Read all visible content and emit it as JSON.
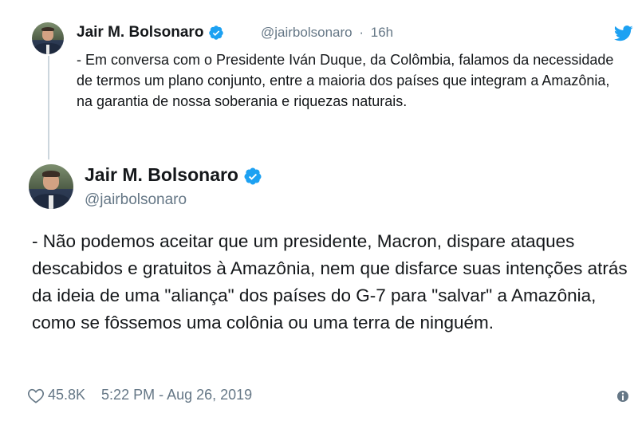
{
  "tweet1": {
    "name": "Jair M. Bolsonaro",
    "handle": "@jairbolsonaro",
    "separator": "·",
    "time_ago": "16h",
    "text": "- Em conversa com o Presidente Iván Duque, da Colômbia, falamos da necessidade de termos um plano conjunto, entre a maioria dos países que integram a Amazônia, na garantia de nossa soberania e riquezas naturais."
  },
  "tweet2": {
    "name": "Jair M. Bolsonaro",
    "handle": "@jairbolsonaro",
    "text": "- Não podemos aceitar que um presidente, Macron, dispare ataques descabidos e gratuitos à Amazônia, nem que disfarce suas intenções atrás da ideia de uma \"aliança\" dos países do G-7 para \"salvar\" a Amazônia, como se fôssemos uma colônia ou uma terra de ninguém.",
    "likes": "45.8K",
    "timestamp": "5:22 PM - Aug 26, 2019"
  },
  "icons": {
    "verified": "verified-badge-icon",
    "bird": "twitter-bird-icon",
    "heart": "heart-icon",
    "info": "info-icon"
  },
  "colors": {
    "accent": "#1da1f2",
    "secondary_text": "#657786",
    "thread_line": "#ccd6dd"
  }
}
